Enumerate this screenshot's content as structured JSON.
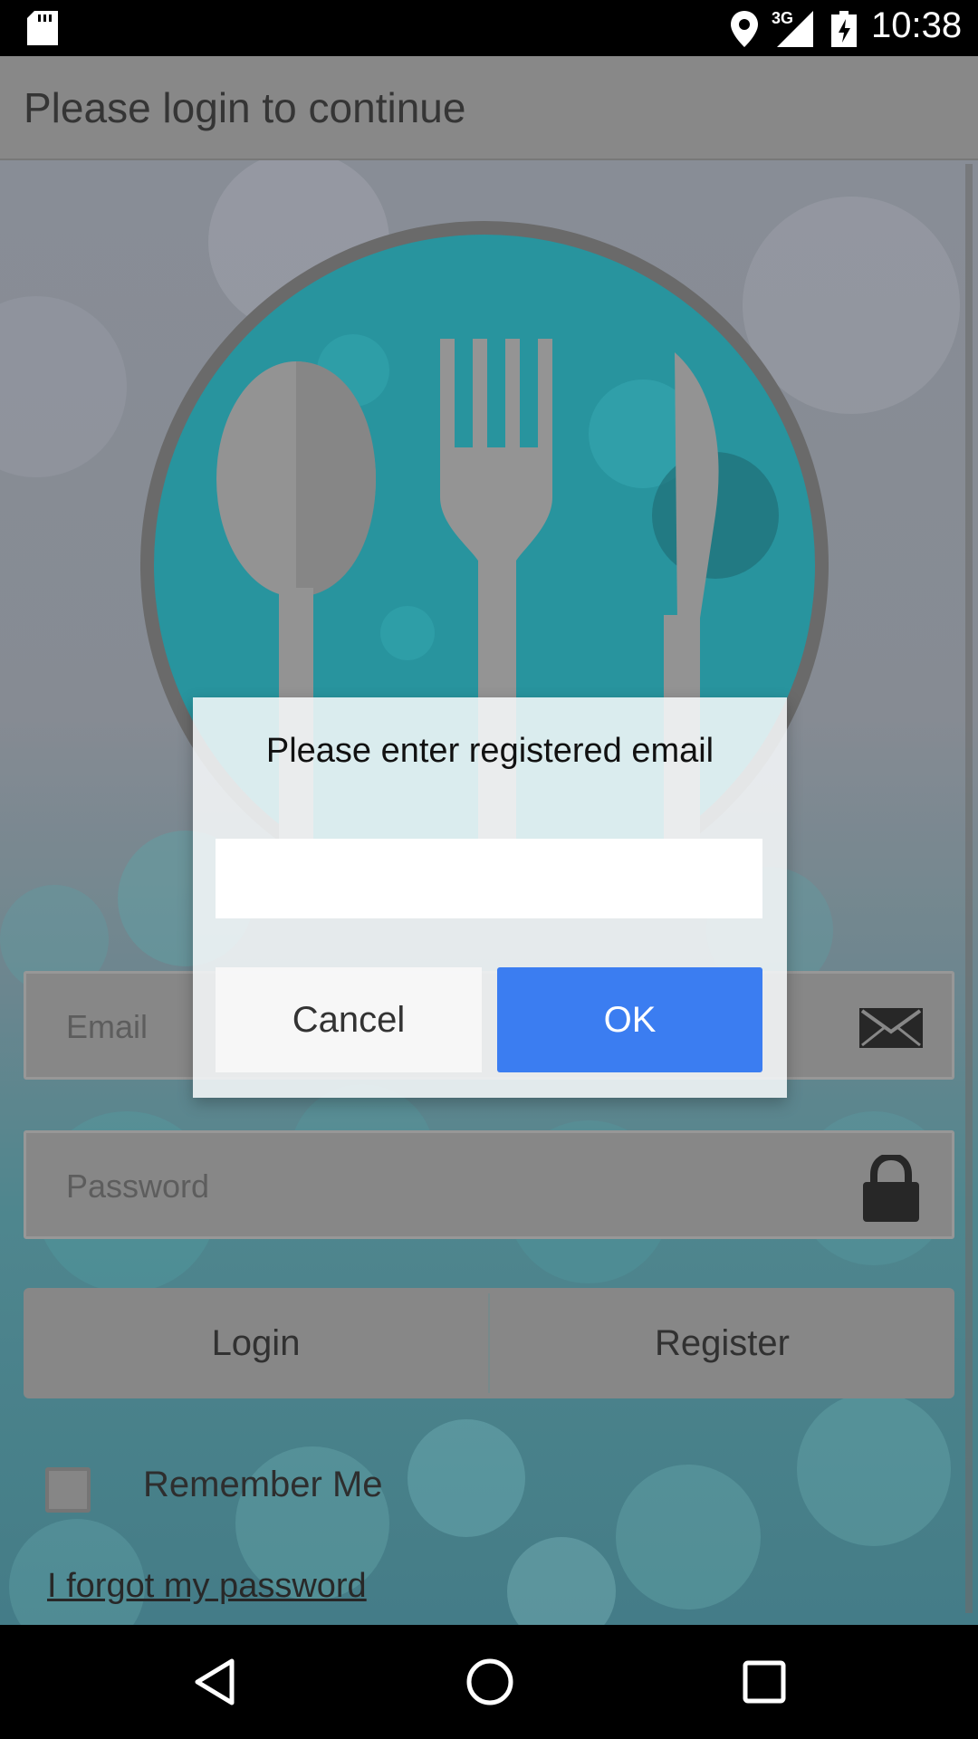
{
  "status_bar": {
    "network_label": "3G",
    "time": "10:38",
    "icons": [
      "sd-card-icon",
      "location-icon",
      "signal-icon",
      "battery-charging-icon"
    ]
  },
  "app_bar": {
    "title": "Please login to continue"
  },
  "login_form": {
    "email_placeholder": "Email",
    "password_placeholder": "Password",
    "login_label": "Login",
    "register_label": "Register",
    "remember_me_label": "Remember Me",
    "remember_me_checked": false,
    "forgot_password_label": "I forgot my password"
  },
  "dialog": {
    "title": "Please enter registered email",
    "input_value": "",
    "cancel_label": "Cancel",
    "ok_label": "OK"
  },
  "nav_bar": {
    "icons": [
      "back-icon",
      "home-icon",
      "recents-icon"
    ]
  },
  "colors": {
    "accent": "#3b7df1",
    "logo_teal": "#1f9aa6"
  }
}
